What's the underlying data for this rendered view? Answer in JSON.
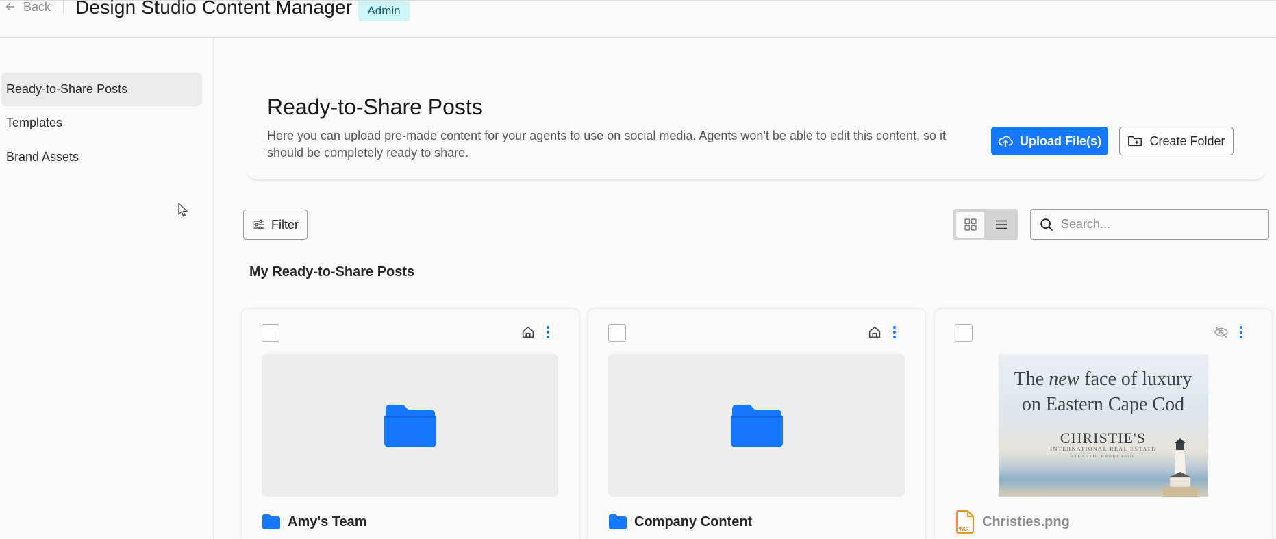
{
  "header": {
    "back_label": "Back",
    "title": "Design Studio Content Manager",
    "role_badge": "Admin"
  },
  "sidebar": {
    "items": [
      {
        "label": "Ready-to-Share Posts",
        "active": true
      },
      {
        "label": "Templates",
        "active": false
      },
      {
        "label": "Brand Assets",
        "active": false
      }
    ]
  },
  "intro": {
    "title": "Ready-to-Share Posts",
    "description": "Here you can upload pre-made content for your agents to use on social media. Agents won't be able to edit this content, so it should be completely ready to share.",
    "upload_label": "Upload File(s)",
    "create_folder_label": "Create Folder"
  },
  "toolbar": {
    "filter_label": "Filter",
    "view_mode": "grid",
    "search_placeholder": "Search..."
  },
  "section": {
    "title": "My Ready-to-Share Posts"
  },
  "cards": [
    {
      "type": "folder",
      "name": "Amy's Team",
      "status_icon": "house-icon"
    },
    {
      "type": "folder",
      "name": "Company Content",
      "status_icon": "house-icon"
    },
    {
      "type": "file",
      "name": "Christies.png",
      "file_badge": "PNG",
      "status_icon": "eye-off-icon",
      "preview": {
        "headline_line1_a": "The ",
        "headline_line1_b": "new",
        "headline_line1_c": " face of luxury",
        "headline_line2": "on Eastern Cape Cod",
        "brand": "CHRISTIE'S",
        "brand_sub": "INTERNATIONAL REAL ESTATE",
        "brand_sub2": "ATLANTIC BROKERAGE"
      }
    }
  ],
  "colors": {
    "primary": "#1677ff",
    "admin_badge_bg": "#cdf4f7",
    "folder": "#1677ff",
    "png_badge": "#f0901e"
  }
}
